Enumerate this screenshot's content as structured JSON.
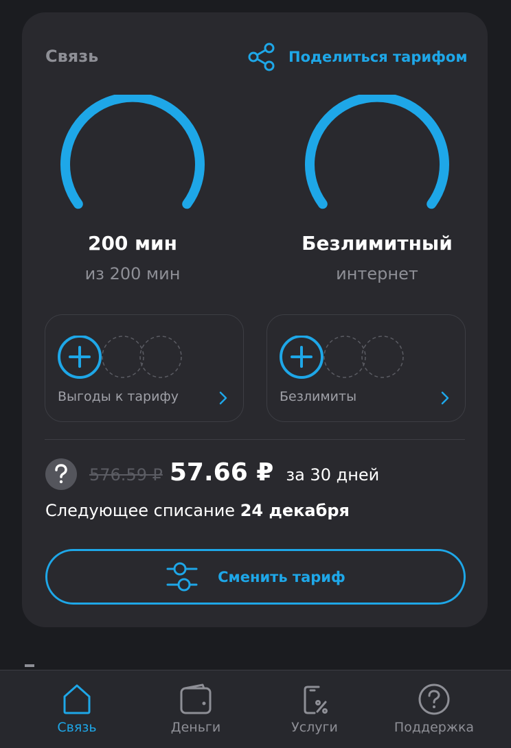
{
  "colors": {
    "accent": "#1ea7e8",
    "card_bg": "#29292e",
    "page_bg": "#1b1c20",
    "muted_text": "#8e8f96"
  },
  "section": {
    "title": "Связь",
    "share_label": "Поделиться тарифом",
    "share_icon": "share-icon"
  },
  "minutes": {
    "value": "200 мин",
    "caption": "из 200 мин",
    "remaining_fraction": 1.0
  },
  "internet": {
    "value": "Безлимитный",
    "caption": "интернет",
    "remaining_fraction": 1.0
  },
  "benefits": {
    "label": "Выгоды к тарифу",
    "add_icon": "plus-circle-icon",
    "chevron_icon": "chevron-right-icon"
  },
  "unlimited": {
    "label": "Безлимиты",
    "add_icon": "plus-circle-icon",
    "chevron_icon": "chevron-right-icon"
  },
  "price": {
    "old": "576.59 ₽",
    "new": "57.66 ₽",
    "period": "за 30 дней",
    "help_icon": "question-icon"
  },
  "next_charge": {
    "label": "Следующее списание",
    "date": "24 декабря"
  },
  "change_tariff": {
    "label": "Сменить тариф",
    "icon": "sliders-icon"
  },
  "nav": {
    "items": [
      {
        "label": "Связь",
        "icon": "home-icon",
        "active": true
      },
      {
        "label": "Деньги",
        "icon": "wallet-icon",
        "active": false
      },
      {
        "label": "Услуги",
        "icon": "services-icon",
        "active": false
      },
      {
        "label": "Поддержка",
        "icon": "support-icon",
        "active": false
      }
    ]
  }
}
